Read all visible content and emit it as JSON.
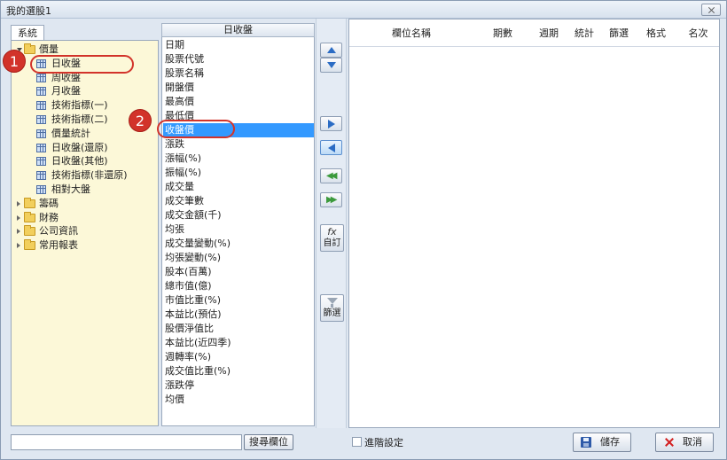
{
  "window": {
    "title": "我的選股1"
  },
  "tree": {
    "tab_label": "系統",
    "items": [
      {
        "label": "價量",
        "type": "folder",
        "open": true,
        "level": 0
      },
      {
        "label": "日收盤",
        "type": "table",
        "level": 1,
        "selected": true
      },
      {
        "label": "周收盤",
        "type": "table",
        "level": 1
      },
      {
        "label": "月收盤",
        "type": "table",
        "level": 1
      },
      {
        "label": "技術指標(一)",
        "type": "table",
        "level": 1
      },
      {
        "label": "技術指標(二)",
        "type": "table",
        "level": 1
      },
      {
        "label": "價量統計",
        "type": "table",
        "level": 1
      },
      {
        "label": "日收盤(還原)",
        "type": "table",
        "level": 1
      },
      {
        "label": "日收盤(其他)",
        "type": "table",
        "level": 1
      },
      {
        "label": "技術指標(非還原)",
        "type": "table",
        "level": 1
      },
      {
        "label": "相對大盤",
        "type": "table",
        "level": 1
      },
      {
        "label": "籌碼",
        "type": "folder",
        "open": false,
        "level": 0
      },
      {
        "label": "財務",
        "type": "folder",
        "open": false,
        "level": 0
      },
      {
        "label": "公司資訊",
        "type": "folder",
        "open": false,
        "level": 0
      },
      {
        "label": "常用報表",
        "type": "folder",
        "open": false,
        "level": 0
      }
    ]
  },
  "field_list": {
    "header": "日收盤",
    "selected_index": 7,
    "items": [
      "日期",
      "股票代號",
      "股票名稱",
      "開盤價",
      "最高價",
      "最低價",
      "收盤價",
      "漲跌",
      "漲幅(%)",
      "振幅(%)",
      "成交量",
      "成交筆數",
      "成交金額(千)",
      "均張",
      "成交量變動(%)",
      "均張變動(%)",
      "股本(百萬)",
      "總市值(億)",
      "市值比重(%)",
      "本益比(預估)",
      "股價淨值比",
      "本益比(近四季)",
      "週轉率(%)",
      "成交值比重(%)",
      "漲跌停",
      "均價"
    ]
  },
  "actions": {
    "custom_label": "自訂",
    "custom_glyph": "fx",
    "filter_label": "篩選"
  },
  "table": {
    "columns": [
      "欄位名稱",
      "期數",
      "週期",
      "統計",
      "篩選",
      "格式",
      "名次"
    ]
  },
  "bottom": {
    "search_value": "",
    "search_button": "搜尋欄位",
    "advanced_label": "進階設定",
    "save_label": "儲存",
    "cancel_label": "取消"
  },
  "annotations": {
    "badge1": "1",
    "badge2": "2"
  }
}
